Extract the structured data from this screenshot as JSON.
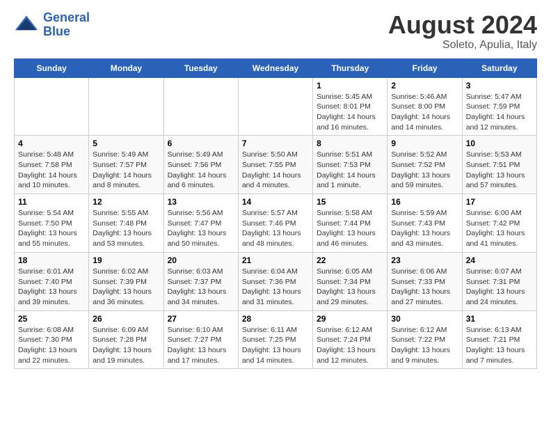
{
  "logo": {
    "line1": "General",
    "line2": "Blue"
  },
  "title": "August 2024",
  "subtitle": "Soleto, Apulia, Italy",
  "weekdays": [
    "Sunday",
    "Monday",
    "Tuesday",
    "Wednesday",
    "Thursday",
    "Friday",
    "Saturday"
  ],
  "weeks": [
    [
      {
        "day": "",
        "info": ""
      },
      {
        "day": "",
        "info": ""
      },
      {
        "day": "",
        "info": ""
      },
      {
        "day": "",
        "info": ""
      },
      {
        "day": "1",
        "info": "Sunrise: 5:45 AM\nSunset: 8:01 PM\nDaylight: 14 hours\nand 16 minutes."
      },
      {
        "day": "2",
        "info": "Sunrise: 5:46 AM\nSunset: 8:00 PM\nDaylight: 14 hours\nand 14 minutes."
      },
      {
        "day": "3",
        "info": "Sunrise: 5:47 AM\nSunset: 7:59 PM\nDaylight: 14 hours\nand 12 minutes."
      }
    ],
    [
      {
        "day": "4",
        "info": "Sunrise: 5:48 AM\nSunset: 7:58 PM\nDaylight: 14 hours\nand 10 minutes."
      },
      {
        "day": "5",
        "info": "Sunrise: 5:49 AM\nSunset: 7:57 PM\nDaylight: 14 hours\nand 8 minutes."
      },
      {
        "day": "6",
        "info": "Sunrise: 5:49 AM\nSunset: 7:56 PM\nDaylight: 14 hours\nand 6 minutes."
      },
      {
        "day": "7",
        "info": "Sunrise: 5:50 AM\nSunset: 7:55 PM\nDaylight: 14 hours\nand 4 minutes."
      },
      {
        "day": "8",
        "info": "Sunrise: 5:51 AM\nSunset: 7:53 PM\nDaylight: 14 hours\nand 1 minute."
      },
      {
        "day": "9",
        "info": "Sunrise: 5:52 AM\nSunset: 7:52 PM\nDaylight: 13 hours\nand 59 minutes."
      },
      {
        "day": "10",
        "info": "Sunrise: 5:53 AM\nSunset: 7:51 PM\nDaylight: 13 hours\nand 57 minutes."
      }
    ],
    [
      {
        "day": "11",
        "info": "Sunrise: 5:54 AM\nSunset: 7:50 PM\nDaylight: 13 hours\nand 55 minutes."
      },
      {
        "day": "12",
        "info": "Sunrise: 5:55 AM\nSunset: 7:48 PM\nDaylight: 13 hours\nand 53 minutes."
      },
      {
        "day": "13",
        "info": "Sunrise: 5:56 AM\nSunset: 7:47 PM\nDaylight: 13 hours\nand 50 minutes."
      },
      {
        "day": "14",
        "info": "Sunrise: 5:57 AM\nSunset: 7:46 PM\nDaylight: 13 hours\nand 48 minutes."
      },
      {
        "day": "15",
        "info": "Sunrise: 5:58 AM\nSunset: 7:44 PM\nDaylight: 13 hours\nand 46 minutes."
      },
      {
        "day": "16",
        "info": "Sunrise: 5:59 AM\nSunset: 7:43 PM\nDaylight: 13 hours\nand 43 minutes."
      },
      {
        "day": "17",
        "info": "Sunrise: 6:00 AM\nSunset: 7:42 PM\nDaylight: 13 hours\nand 41 minutes."
      }
    ],
    [
      {
        "day": "18",
        "info": "Sunrise: 6:01 AM\nSunset: 7:40 PM\nDaylight: 13 hours\nand 39 minutes."
      },
      {
        "day": "19",
        "info": "Sunrise: 6:02 AM\nSunset: 7:39 PM\nDaylight: 13 hours\nand 36 minutes."
      },
      {
        "day": "20",
        "info": "Sunrise: 6:03 AM\nSunset: 7:37 PM\nDaylight: 13 hours\nand 34 minutes."
      },
      {
        "day": "21",
        "info": "Sunrise: 6:04 AM\nSunset: 7:36 PM\nDaylight: 13 hours\nand 31 minutes."
      },
      {
        "day": "22",
        "info": "Sunrise: 6:05 AM\nSunset: 7:34 PM\nDaylight: 13 hours\nand 29 minutes."
      },
      {
        "day": "23",
        "info": "Sunrise: 6:06 AM\nSunset: 7:33 PM\nDaylight: 13 hours\nand 27 minutes."
      },
      {
        "day": "24",
        "info": "Sunrise: 6:07 AM\nSunset: 7:31 PM\nDaylight: 13 hours\nand 24 minutes."
      }
    ],
    [
      {
        "day": "25",
        "info": "Sunrise: 6:08 AM\nSunset: 7:30 PM\nDaylight: 13 hours\nand 22 minutes."
      },
      {
        "day": "26",
        "info": "Sunrise: 6:09 AM\nSunset: 7:28 PM\nDaylight: 13 hours\nand 19 minutes."
      },
      {
        "day": "27",
        "info": "Sunrise: 6:10 AM\nSunset: 7:27 PM\nDaylight: 13 hours\nand 17 minutes."
      },
      {
        "day": "28",
        "info": "Sunrise: 6:11 AM\nSunset: 7:25 PM\nDaylight: 13 hours\nand 14 minutes."
      },
      {
        "day": "29",
        "info": "Sunrise: 6:12 AM\nSunset: 7:24 PM\nDaylight: 13 hours\nand 12 minutes."
      },
      {
        "day": "30",
        "info": "Sunrise: 6:12 AM\nSunset: 7:22 PM\nDaylight: 13 hours\nand 9 minutes."
      },
      {
        "day": "31",
        "info": "Sunrise: 6:13 AM\nSunset: 7:21 PM\nDaylight: 13 hours\nand 7 minutes."
      }
    ]
  ]
}
